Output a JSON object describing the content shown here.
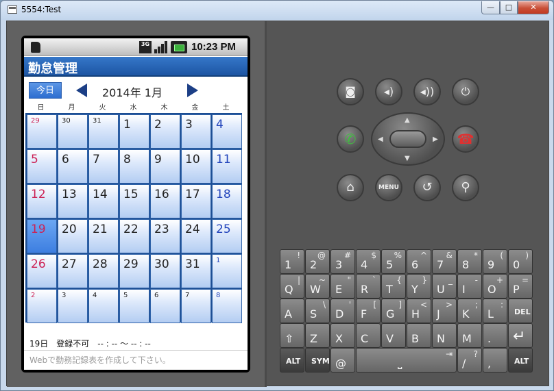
{
  "window": {
    "title": "5554:Test",
    "min_label": "—",
    "max_label": "□",
    "close_label": "✕"
  },
  "status_bar": {
    "network": "3G",
    "time": "10:23 PM"
  },
  "app": {
    "title": "勤怠管理"
  },
  "calendar": {
    "today_button": "今日",
    "month_label": "2014年 1月",
    "weekdays": [
      "日",
      "月",
      "火",
      "水",
      "木",
      "金",
      "土"
    ],
    "weeks": [
      [
        "29",
        "30",
        "31",
        "1",
        "2",
        "3",
        "4"
      ],
      [
        "5",
        "6",
        "7",
        "8",
        "9",
        "10",
        "11"
      ],
      [
        "12",
        "13",
        "14",
        "15",
        "16",
        "17",
        "18"
      ],
      [
        "19",
        "20",
        "21",
        "22",
        "23",
        "24",
        "25"
      ],
      [
        "26",
        "27",
        "28",
        "29",
        "30",
        "31",
        "1"
      ],
      [
        "2",
        "3",
        "4",
        "5",
        "6",
        "7",
        "8"
      ]
    ]
  },
  "footer": {
    "info": "19日　登録不可　-- : --  ～  -- : --",
    "hint": "Webで勤務記録表を作成して下さい。"
  },
  "controls": {
    "menu_label": "MENU"
  },
  "keyboard": {
    "row1": [
      {
        "m": "1",
        "a": "!"
      },
      {
        "m": "2",
        "a": "@"
      },
      {
        "m": "3",
        "a": "#"
      },
      {
        "m": "4",
        "a": "$"
      },
      {
        "m": "5",
        "a": "%"
      },
      {
        "m": "6",
        "a": "^"
      },
      {
        "m": "7",
        "a": "&"
      },
      {
        "m": "8",
        "a": "*"
      },
      {
        "m": "9",
        "a": "("
      },
      {
        "m": "0",
        "a": ")"
      }
    ],
    "row2": [
      {
        "m": "Q",
        "a": "|"
      },
      {
        "m": "W",
        "a": "~"
      },
      {
        "m": "E",
        "a": "\""
      },
      {
        "m": "R",
        "a": "`"
      },
      {
        "m": "T",
        "a": "{"
      },
      {
        "m": "Y",
        "a": "}"
      },
      {
        "m": "U",
        "a": "_"
      },
      {
        "m": "I",
        "a": "-"
      },
      {
        "m": "O",
        "a": "+"
      },
      {
        "m": "P",
        "a": "="
      }
    ],
    "row3": [
      {
        "m": "A",
        "a": ""
      },
      {
        "m": "S",
        "a": "\\"
      },
      {
        "m": "D",
        "a": "'"
      },
      {
        "m": "F",
        "a": "["
      },
      {
        "m": "G",
        "a": "]"
      },
      {
        "m": "H",
        "a": "<"
      },
      {
        "m": "J",
        "a": ">"
      },
      {
        "m": "K",
        "a": ";"
      },
      {
        "m": "L",
        "a": ":"
      }
    ],
    "del_label": "DEL",
    "row4": [
      "Z",
      "X",
      "C",
      "V",
      "B",
      "N",
      "M",
      "."
    ],
    "alt_label": "ALT",
    "sym_label": "SYM",
    "at_label": "@",
    "slash": {
      "m": "/",
      "a": "?"
    },
    "comma": ","
  }
}
